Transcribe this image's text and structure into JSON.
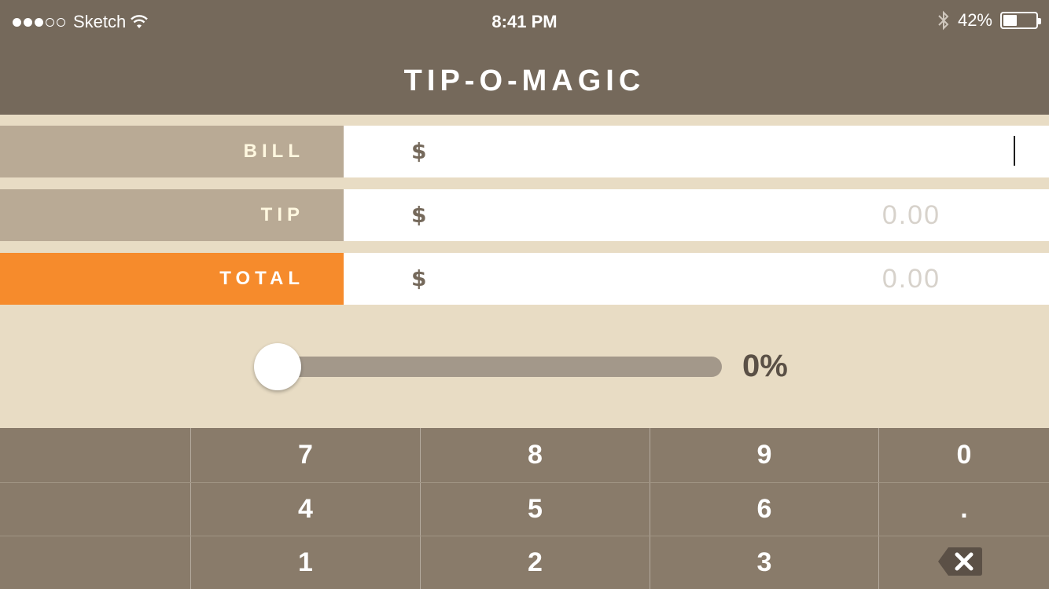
{
  "status_bar": {
    "carrier": "Sketch",
    "time": "8:41 PM",
    "battery_percent": "42%",
    "battery_level": 0.42,
    "signal_dots_filled": 3,
    "signal_dots_total": 5
  },
  "app": {
    "title": "TIP-O-MAGIC"
  },
  "rows": {
    "bill": {
      "label": "BILL",
      "currency": "$",
      "value": ""
    },
    "tip": {
      "label": "TIP",
      "currency": "$",
      "value": "0.00"
    },
    "total": {
      "label": "TOTAL",
      "currency": "$",
      "value": "0.00"
    }
  },
  "slider": {
    "value_label": "0%",
    "fraction": 0.0
  },
  "keypad": {
    "row1": [
      "7",
      "8",
      "9",
      "0"
    ],
    "row2": [
      "4",
      "5",
      "6",
      "."
    ],
    "row3": [
      "1",
      "2",
      "3"
    ],
    "backspace_icon": "backspace-icon"
  },
  "colors": {
    "header": "#75695b",
    "background": "#e8dcc4",
    "label_bg": "#b9aa95",
    "total_accent": "#f68b2c",
    "keypad_bg": "#897b6a"
  }
}
